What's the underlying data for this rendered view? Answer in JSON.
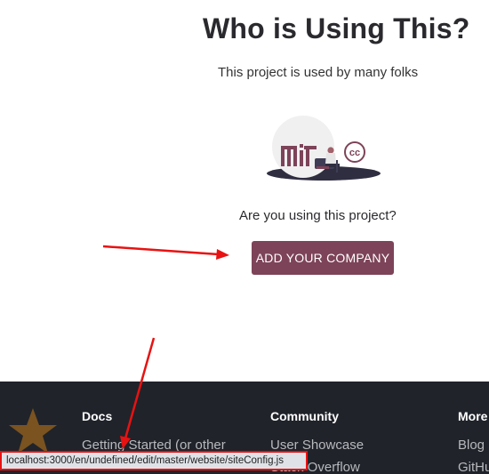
{
  "showcase": {
    "title": "Who is Using This?",
    "subtitle": "This project is used by many folks",
    "user_logo_icon": "mit-cc-logo",
    "cta_prompt": "Are you using this project?",
    "cta_button_label": "ADD YOUR COMPANY"
  },
  "footer": {
    "logo_icon": "star-icon",
    "columns": [
      {
        "heading": "Docs",
        "links": [
          "Getting Started (or other",
          ""
        ]
      },
      {
        "heading": "Community",
        "links": [
          "User Showcase",
          "Stack Overflow"
        ]
      },
      {
        "heading": "More",
        "links": [
          "Blog",
          "GitHub"
        ]
      }
    ]
  },
  "status_bar": {
    "url": "localhost:3000/en/undefined/edit/master/website/siteConfig.js"
  },
  "colors": {
    "button_bg": "#7d4358",
    "footer_bg": "#20232a",
    "annotation_red": "#e81212",
    "status_bar_bg": "#dfe3e8"
  }
}
